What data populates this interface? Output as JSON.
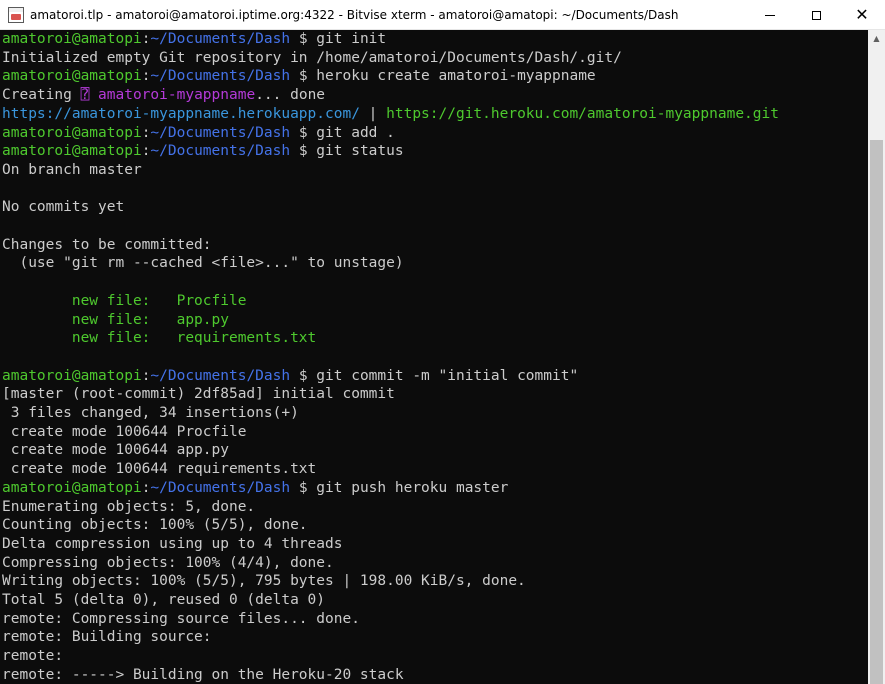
{
  "window": {
    "title": "amatoroi.tlp - amatoroi@amatoroi.iptime.org:4322 - Bitvise xterm - amatoroi@amatopi: ~/Documents/Dash",
    "minimize_label": "",
    "maximize_label": "",
    "close_label": "✕"
  },
  "colors": {
    "prompt_user": "#4ec92e",
    "prompt_path": "#4472e8",
    "output": "#cccccc",
    "app_name": "#b43ad8",
    "url": "#3a96dd",
    "staged_file": "#4ec92e"
  },
  "terminal": {
    "prompt_user": "amatoroi@amatopi",
    "prompt_path": "~/Documents/Dash",
    "prompt_symbol": "$",
    "lines": [
      {
        "segments": [
          {
            "t": "amatoroi@amatopi",
            "c": "green"
          },
          {
            "t": ":",
            "c": "white"
          },
          {
            "t": "~/Documents/Dash",
            "c": "blue"
          },
          {
            "t": " $ git init",
            "c": "white"
          }
        ]
      },
      {
        "segments": [
          {
            "t": "Initialized empty Git repository in /home/amatoroi/Documents/Dash/.git/",
            "c": "white"
          }
        ]
      },
      {
        "segments": [
          {
            "t": "amatoroi@amatopi",
            "c": "green"
          },
          {
            "t": ":",
            "c": "white"
          },
          {
            "t": "~/Documents/Dash",
            "c": "blue"
          },
          {
            "t": " $ heroku create amatoroi-myappname",
            "c": "white"
          }
        ]
      },
      {
        "segments": [
          {
            "t": "Creating ",
            "c": "white"
          },
          {
            "t": "⍰ amatoroi-myappname",
            "c": "magenta"
          },
          {
            "t": "... done",
            "c": "white"
          }
        ]
      },
      {
        "segments": [
          {
            "t": "https://amatoroi-myappname.herokuapp.com/",
            "c": "cyan"
          },
          {
            "t": " | ",
            "c": "white"
          },
          {
            "t": "https://git.heroku.com/amatoroi-myappname.git",
            "c": "green"
          }
        ]
      },
      {
        "segments": [
          {
            "t": "amatoroi@amatopi",
            "c": "green"
          },
          {
            "t": ":",
            "c": "white"
          },
          {
            "t": "~/Documents/Dash",
            "c": "blue"
          },
          {
            "t": " $ git add .",
            "c": "white"
          }
        ]
      },
      {
        "segments": [
          {
            "t": "amatoroi@amatopi",
            "c": "green"
          },
          {
            "t": ":",
            "c": "white"
          },
          {
            "t": "~/Documents/Dash",
            "c": "blue"
          },
          {
            "t": " $ git status",
            "c": "white"
          }
        ]
      },
      {
        "segments": [
          {
            "t": "On branch master",
            "c": "white"
          }
        ]
      },
      {
        "segments": [
          {
            "t": "",
            "c": "white"
          }
        ]
      },
      {
        "segments": [
          {
            "t": "No commits yet",
            "c": "white"
          }
        ]
      },
      {
        "segments": [
          {
            "t": "",
            "c": "white"
          }
        ]
      },
      {
        "segments": [
          {
            "t": "Changes to be committed:",
            "c": "white"
          }
        ]
      },
      {
        "segments": [
          {
            "t": "  (use \"git rm --cached <file>...\" to unstage)",
            "c": "white"
          }
        ]
      },
      {
        "segments": [
          {
            "t": "",
            "c": "white"
          }
        ]
      },
      {
        "segments": [
          {
            "t": "        new file:   Procfile",
            "c": "green"
          }
        ]
      },
      {
        "segments": [
          {
            "t": "        new file:   app.py",
            "c": "green"
          }
        ]
      },
      {
        "segments": [
          {
            "t": "        new file:   requirements.txt",
            "c": "green"
          }
        ]
      },
      {
        "segments": [
          {
            "t": "",
            "c": "white"
          }
        ]
      },
      {
        "segments": [
          {
            "t": "amatoroi@amatopi",
            "c": "green"
          },
          {
            "t": ":",
            "c": "white"
          },
          {
            "t": "~/Documents/Dash",
            "c": "blue"
          },
          {
            "t": " $ git commit -m \"initial commit\"",
            "c": "white"
          }
        ]
      },
      {
        "segments": [
          {
            "t": "[master (root-commit) 2df85ad] initial commit",
            "c": "white"
          }
        ]
      },
      {
        "segments": [
          {
            "t": " 3 files changed, 34 insertions(+)",
            "c": "white"
          }
        ]
      },
      {
        "segments": [
          {
            "t": " create mode 100644 Procfile",
            "c": "white"
          }
        ]
      },
      {
        "segments": [
          {
            "t": " create mode 100644 app.py",
            "c": "white"
          }
        ]
      },
      {
        "segments": [
          {
            "t": " create mode 100644 requirements.txt",
            "c": "white"
          }
        ]
      },
      {
        "segments": [
          {
            "t": "amatoroi@amatopi",
            "c": "green"
          },
          {
            "t": ":",
            "c": "white"
          },
          {
            "t": "~/Documents/Dash",
            "c": "blue"
          },
          {
            "t": " $ git push heroku master",
            "c": "white"
          }
        ]
      },
      {
        "segments": [
          {
            "t": "Enumerating objects: 5, done.",
            "c": "white"
          }
        ]
      },
      {
        "segments": [
          {
            "t": "Counting objects: 100% (5/5), done.",
            "c": "white"
          }
        ]
      },
      {
        "segments": [
          {
            "t": "Delta compression using up to 4 threads",
            "c": "white"
          }
        ]
      },
      {
        "segments": [
          {
            "t": "Compressing objects: 100% (4/4), done.",
            "c": "white"
          }
        ]
      },
      {
        "segments": [
          {
            "t": "Writing objects: 100% (5/5), 795 bytes | 198.00 KiB/s, done.",
            "c": "white"
          }
        ]
      },
      {
        "segments": [
          {
            "t": "Total 5 (delta 0), reused 0 (delta 0)",
            "c": "white"
          }
        ]
      },
      {
        "segments": [
          {
            "t": "remote: Compressing source files... done.",
            "c": "white"
          }
        ]
      },
      {
        "segments": [
          {
            "t": "remote: Building source:",
            "c": "white"
          }
        ]
      },
      {
        "segments": [
          {
            "t": "remote:",
            "c": "white"
          }
        ]
      },
      {
        "segments": [
          {
            "t": "remote: -----> Building on the Heroku-20 stack",
            "c": "white"
          }
        ]
      }
    ]
  },
  "scrollbar": {
    "up_arrow": "▲"
  }
}
